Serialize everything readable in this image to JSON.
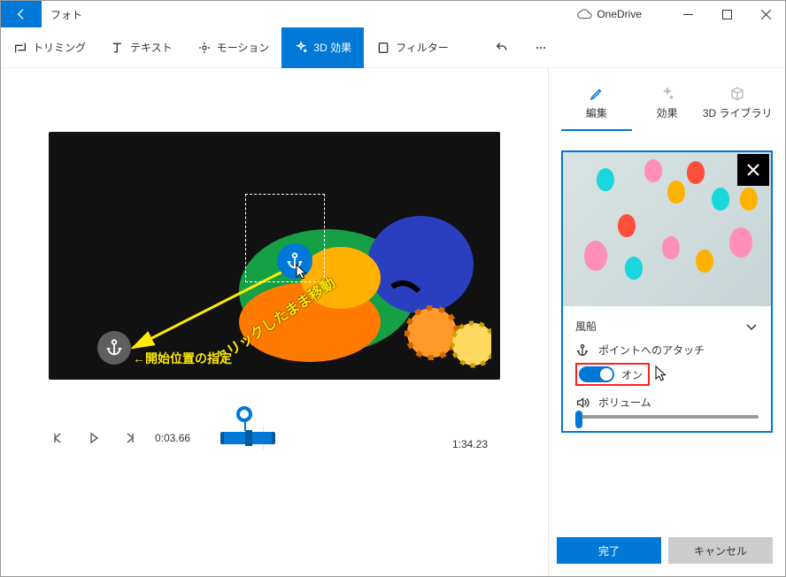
{
  "titlebar": {
    "app_title": "フォト",
    "cloud_label": "OneDrive"
  },
  "toolbar": {
    "trim": "トリミング",
    "text": "テキスト",
    "motion": "モーション",
    "fx3d": "3D 効果",
    "filter": "フィルター"
  },
  "preview": {
    "annotation_move": "クリックしたまま移動",
    "annotation_start": "←開始位置の指定"
  },
  "playback": {
    "current": "0:03.66",
    "total": "1:34.23"
  },
  "side_tabs": {
    "edit": "編集",
    "effects": "効果",
    "library": "3D ライブラリ"
  },
  "effect": {
    "name": "風船",
    "attach_label": "ポイントへのアタッチ",
    "toggle_state": "オン",
    "volume_label": "ボリューム"
  },
  "buttons": {
    "done": "完了",
    "cancel": "キャンセル"
  },
  "colors": {
    "accent": "#0078d7",
    "highlight": "#ff2020"
  }
}
